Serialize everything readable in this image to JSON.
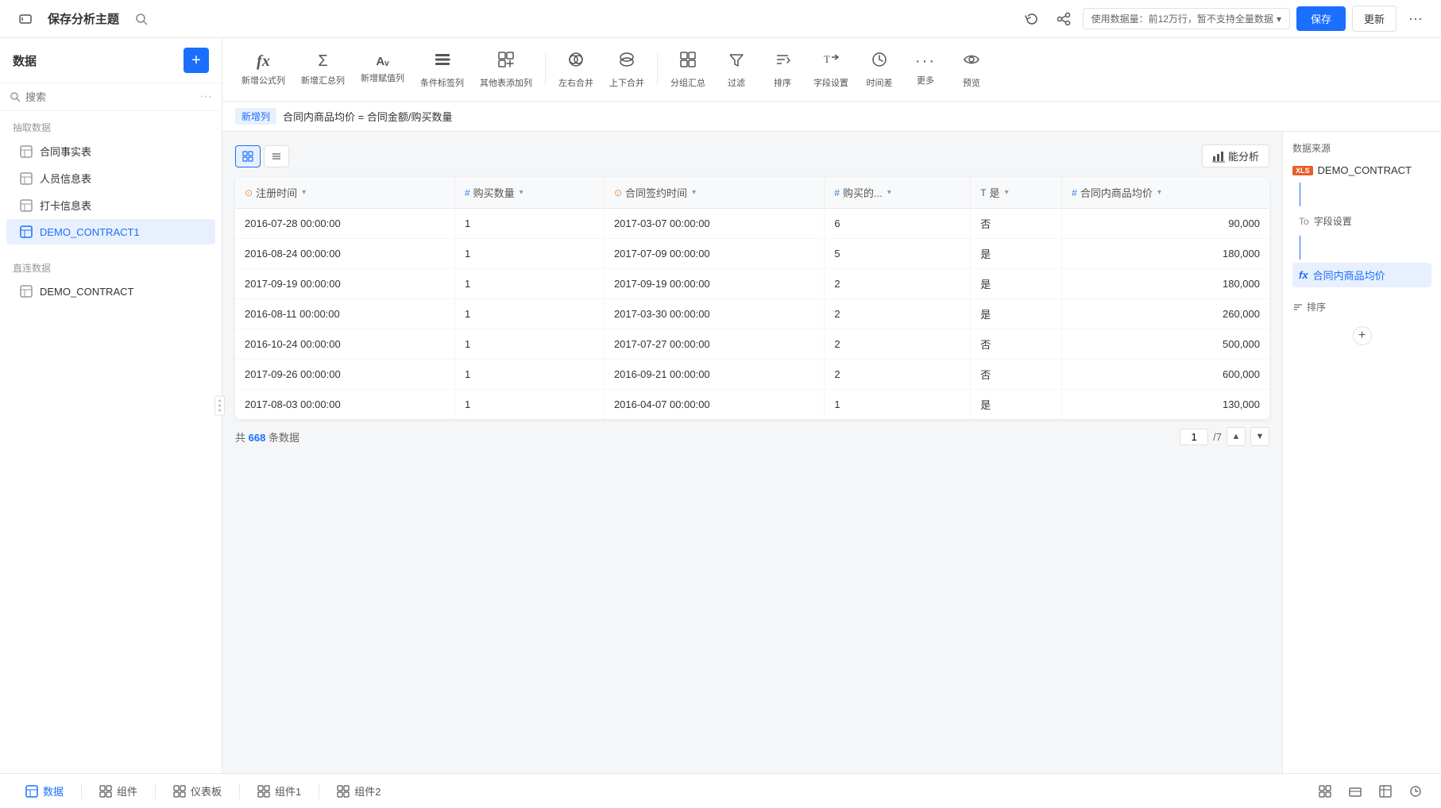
{
  "topbar": {
    "back_icon": "←",
    "title": "保存分析主题",
    "search_icon": "⊙",
    "refresh_icon": "↻",
    "flow_icon": "⋈",
    "data_usage": "使用数据量：前12万行，暂不支持全量数据",
    "dropdown_icon": "▾",
    "save_label": "保存",
    "update_label": "更新",
    "more_icon": "···"
  },
  "sidebar": {
    "title": "数据",
    "add_icon": "+",
    "search_placeholder": "搜索",
    "search_icon": "🔍",
    "more_icon": "···",
    "section1_title": "抽取数据",
    "items1": [
      {
        "id": "contract-fact",
        "icon": "table",
        "label": "合同事实表"
      },
      {
        "id": "personnel",
        "icon": "table",
        "label": "人员信息表"
      },
      {
        "id": "checkin",
        "icon": "table",
        "label": "打卡信息表"
      },
      {
        "id": "demo-contract1",
        "icon": "table",
        "label": "DEMO_CONTRACT1",
        "active": true
      }
    ],
    "section2_title": "直连数据",
    "items2": [
      {
        "id": "demo-contract",
        "icon": "table",
        "label": "DEMO_CONTRACT"
      }
    ]
  },
  "toolbar": {
    "items": [
      {
        "id": "formula-col",
        "icon": "fx",
        "label": "新增公式列"
      },
      {
        "id": "agg-col",
        "icon": "Σ",
        "label": "新增汇总列"
      },
      {
        "id": "value-col",
        "icon": "AA",
        "label": "新增赋值列"
      },
      {
        "id": "condition-tag",
        "icon": "≡↓",
        "label": "条件标签列"
      },
      {
        "id": "other-add",
        "icon": "⊞",
        "label": "其他表添加列"
      },
      {
        "id": "lr-merge",
        "icon": "⊙",
        "label": "左右合并"
      },
      {
        "id": "tb-merge",
        "icon": "⊙",
        "label": "上下合并"
      },
      {
        "id": "group-agg",
        "icon": "⊞",
        "label": "分组汇总"
      },
      {
        "id": "filter",
        "icon": "▽",
        "label": "过滤"
      },
      {
        "id": "sort",
        "icon": "↕",
        "label": "排序"
      },
      {
        "id": "field-settings",
        "icon": "T↑",
        "label": "字段设置"
      },
      {
        "id": "time-diff",
        "icon": "⊙",
        "label": "时间差"
      },
      {
        "id": "more",
        "icon": "···",
        "label": "更多"
      },
      {
        "id": "preview",
        "icon": "👁",
        "label": "预览"
      }
    ]
  },
  "formula_bar": {
    "new_label": "新增列",
    "formula": "合同内商品均价 = 合同金额/购买数量"
  },
  "table": {
    "view_grid_icon": "⊞",
    "view_list_icon": "☰",
    "analysis_icon": "📊",
    "analysis_label": "能分析",
    "columns": [
      {
        "id": "reg-time",
        "type": "time",
        "type_icon": "⊙",
        "label": "注册时间",
        "has_arrow": true
      },
      {
        "id": "buy-qty",
        "type": "num",
        "type_icon": "#",
        "label": "购买数量",
        "has_arrow": true
      },
      {
        "id": "contract-sign-time",
        "type": "time",
        "type_icon": "⊙",
        "label": "合同签约时间",
        "has_arrow": true
      },
      {
        "id": "bought",
        "type": "num",
        "type_icon": "#",
        "label": "购买的...",
        "has_arrow": true
      },
      {
        "id": "is-col",
        "type": "text",
        "type_icon": "T",
        "label": "是",
        "has_arrow": true
      },
      {
        "id": "avg-price",
        "type": "num",
        "type_icon": "#",
        "label": "合同内商品均价",
        "has_arrow": true
      }
    ],
    "rows": [
      {
        "reg_time": "2016-07-28 00:00:00",
        "buy_qty": "1",
        "sign_time": "2017-03-07 00:00:00",
        "bought": "6",
        "is_val": "否",
        "avg_price": "90,000"
      },
      {
        "reg_time": "2016-08-24 00:00:00",
        "buy_qty": "1",
        "sign_time": "2017-07-09 00:00:00",
        "bought": "5",
        "is_val": "是",
        "avg_price": "180,000"
      },
      {
        "reg_time": "2017-09-19 00:00:00",
        "buy_qty": "1",
        "sign_time": "2017-09-19 00:00:00",
        "bought": "2",
        "is_val": "是",
        "avg_price": "180,000"
      },
      {
        "reg_time": "2016-08-11 00:00:00",
        "buy_qty": "1",
        "sign_time": "2017-03-30 00:00:00",
        "bought": "2",
        "is_val": "是",
        "avg_price": "260,000"
      },
      {
        "reg_time": "2016-10-24 00:00:00",
        "buy_qty": "1",
        "sign_time": "2017-07-27 00:00:00",
        "bought": "2",
        "is_val": "否",
        "avg_price": "500,000"
      },
      {
        "reg_time": "2017-09-26 00:00:00",
        "buy_qty": "1",
        "sign_time": "2016-09-21 00:00:00",
        "bought": "2",
        "is_val": "否",
        "avg_price": "600,000"
      },
      {
        "reg_time": "2017-08-03 00:00:00",
        "buy_qty": "1",
        "sign_time": "2016-04-07 00:00:00",
        "bought": "1",
        "is_val": "是",
        "avg_price": "130,000"
      }
    ],
    "total_label": "共",
    "total_count": "668",
    "total_suffix": "条数据",
    "page_current": "1",
    "page_total": "/7"
  },
  "right_panel": {
    "datasource_title": "数据来源",
    "datasource_icon": "XLS",
    "datasource_name": "DEMO_CONTRACT",
    "field_settings_label": "字段设置",
    "formula_field_icon": "fx",
    "formula_field_label": "合同内商品均价",
    "sort_section_icon": "↕",
    "sort_section_label": "排序",
    "add_icon": "+"
  },
  "bottom_tabs": [
    {
      "id": "data",
      "icon": "≡",
      "label": "数据",
      "active": true
    },
    {
      "id": "component",
      "icon": "⊞",
      "label": "组件"
    },
    {
      "id": "dashboard",
      "icon": "⊞",
      "label": "仪表板"
    },
    {
      "id": "component1",
      "icon": "⊞",
      "label": "组件1"
    },
    {
      "id": "component2",
      "icon": "⊞",
      "label": "组件2"
    }
  ],
  "bottom_right_icons": [
    "⊞",
    "⊞",
    "⊞",
    "⊙"
  ]
}
